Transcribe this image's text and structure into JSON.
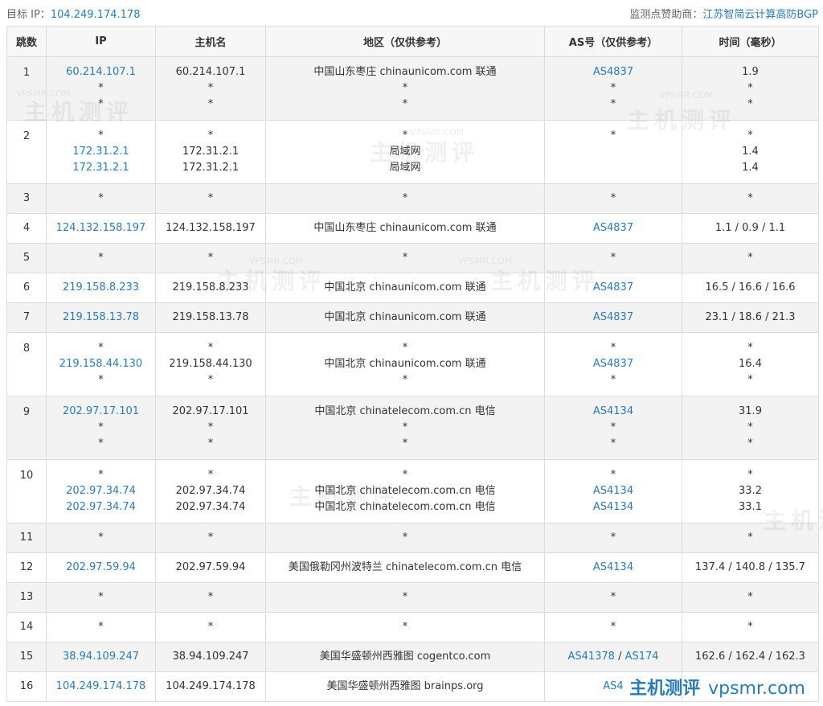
{
  "top": {
    "target_label": "目标 IP：",
    "target_ip": "104.249.174.178",
    "sponsor_label": "监测点赞助商：",
    "sponsor_name": "江苏智简云计算高防BGP"
  },
  "headers": [
    "跳数",
    "IP",
    "主机名",
    "地区（仅供参考）",
    "AS号（仅供参考）",
    "时间（毫秒）"
  ],
  "hops": [
    {
      "hop": "1",
      "ip": [
        "60.214.107.1",
        "*",
        "*"
      ],
      "host": [
        "60.214.107.1",
        "*",
        "*"
      ],
      "region": [
        "中国山东枣庄 chinaunicom.com 联通",
        "*",
        "*"
      ],
      "as": [
        [
          "AS4837"
        ],
        [
          "*"
        ],
        [
          "*"
        ]
      ],
      "time": [
        "1.9",
        "*",
        "*"
      ]
    },
    {
      "hop": "2",
      "ip": [
        "*",
        "172.31.2.1",
        "172.31.2.1"
      ],
      "host": [
        "*",
        "172.31.2.1",
        "172.31.2.1"
      ],
      "region": [
        "*",
        "局域网",
        "局域网"
      ],
      "as": [
        [
          "*"
        ],
        [
          ""
        ],
        [
          ""
        ]
      ],
      "time": [
        "*",
        "1.4",
        "1.4"
      ]
    },
    {
      "hop": "3",
      "ip": [
        "*"
      ],
      "host": [
        "*"
      ],
      "region": [
        "*"
      ],
      "as": [
        [
          "*"
        ]
      ],
      "time": [
        "*"
      ]
    },
    {
      "hop": "4",
      "ip": [
        "124.132.158.197"
      ],
      "host": [
        "124.132.158.197"
      ],
      "region": [
        "中国山东枣庄 chinaunicom.com 联通"
      ],
      "as": [
        [
          "AS4837"
        ]
      ],
      "time": [
        "1.1 / 0.9 / 1.1"
      ]
    },
    {
      "hop": "5",
      "ip": [
        "*"
      ],
      "host": [
        "*"
      ],
      "region": [
        "*"
      ],
      "as": [
        [
          "*"
        ]
      ],
      "time": [
        "*"
      ]
    },
    {
      "hop": "6",
      "ip": [
        "219.158.8.233"
      ],
      "host": [
        "219.158.8.233"
      ],
      "region": [
        "中国北京 chinaunicom.com 联通"
      ],
      "as": [
        [
          "AS4837"
        ]
      ],
      "time": [
        "16.5 / 16.6 / 16.6"
      ]
    },
    {
      "hop": "7",
      "ip": [
        "219.158.13.78"
      ],
      "host": [
        "219.158.13.78"
      ],
      "region": [
        "中国北京 chinaunicom.com 联通"
      ],
      "as": [
        [
          "AS4837"
        ]
      ],
      "time": [
        "23.1 / 18.6 / 21.3"
      ]
    },
    {
      "hop": "8",
      "ip": [
        "*",
        "219.158.44.130",
        "*"
      ],
      "host": [
        "*",
        "219.158.44.130",
        "*"
      ],
      "region": [
        "*",
        "中国北京 chinaunicom.com 联通",
        "*"
      ],
      "as": [
        [
          "*"
        ],
        [
          "AS4837"
        ],
        [
          "*"
        ]
      ],
      "time": [
        "*",
        "16.4",
        "*"
      ]
    },
    {
      "hop": "9",
      "ip": [
        "202.97.17.101",
        "*",
        "*"
      ],
      "host": [
        "202.97.17.101",
        "*",
        "*"
      ],
      "region": [
        "中国北京 chinatelecom.com.cn 电信",
        "*",
        "*"
      ],
      "as": [
        [
          "AS4134"
        ],
        [
          "*"
        ],
        [
          "*"
        ]
      ],
      "time": [
        "31.9",
        "*",
        "*"
      ]
    },
    {
      "hop": "10",
      "ip": [
        "*",
        "202.97.34.74",
        "202.97.34.74"
      ],
      "host": [
        "*",
        "202.97.34.74",
        "202.97.34.74"
      ],
      "region": [
        "*",
        "中国北京 chinatelecom.com.cn 电信",
        "中国北京 chinatelecom.com.cn 电信"
      ],
      "as": [
        [
          "*"
        ],
        [
          "AS4134"
        ],
        [
          "AS4134"
        ]
      ],
      "time": [
        "*",
        "33.2",
        "33.1"
      ]
    },
    {
      "hop": "11",
      "ip": [
        "*"
      ],
      "host": [
        "*"
      ],
      "region": [
        "*"
      ],
      "as": [
        [
          "*"
        ]
      ],
      "time": [
        "*"
      ]
    },
    {
      "hop": "12",
      "ip": [
        "202.97.59.94"
      ],
      "host": [
        "202.97.59.94"
      ],
      "region": [
        "美国俄勒冈州波特兰 chinatelecom.com.cn 电信"
      ],
      "as": [
        [
          "AS4134"
        ]
      ],
      "time": [
        "137.4 / 140.8 / 135.7"
      ]
    },
    {
      "hop": "13",
      "ip": [
        "*"
      ],
      "host": [
        "*"
      ],
      "region": [
        "*"
      ],
      "as": [
        [
          "*"
        ]
      ],
      "time": [
        "*"
      ]
    },
    {
      "hop": "14",
      "ip": [
        "*"
      ],
      "host": [
        "*"
      ],
      "region": [
        "*"
      ],
      "as": [
        [
          "*"
        ]
      ],
      "time": [
        "*"
      ]
    },
    {
      "hop": "15",
      "ip": [
        "38.94.109.247"
      ],
      "host": [
        "38.94.109.247"
      ],
      "region": [
        "美国华盛顿州西雅图 cogentco.com"
      ],
      "as": [
        [
          "AS41378",
          "AS174"
        ]
      ],
      "time": [
        "162.6 / 162.4 / 162.3"
      ]
    },
    {
      "hop": "16",
      "ip": [
        "104.249.174.178"
      ],
      "host": [
        "104.249.174.178"
      ],
      "region": [
        "美国华盛顿州西雅图 brainps.org"
      ],
      "as": [
        [
          "AS4"
        ]
      ],
      "time": [
        ""
      ]
    }
  ],
  "watermark": {
    "text": "主机测评",
    "sub": "VPSMR.COM"
  },
  "brand": {
    "name": "主机测评",
    "url": "vpsmr.com"
  }
}
